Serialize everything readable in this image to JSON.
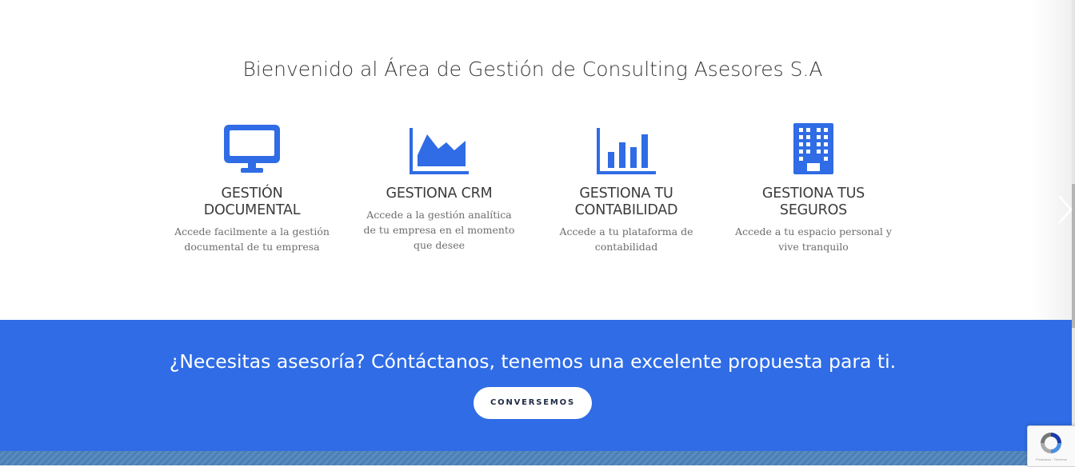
{
  "header": {
    "title": "Bienvenido al Área de Gestión de Consulting Asesores S.A"
  },
  "features": [
    {
      "icon": "monitor-icon",
      "title": "GESTIÓN DOCUMENTAL",
      "desc": "Accede facilmente a la gestión documental de tu empresa"
    },
    {
      "icon": "area-chart-icon",
      "title": "GESTIONA CRM",
      "desc": "Accede a la gestión analítica de tu empresa en el momento que desee"
    },
    {
      "icon": "bar-chart-icon",
      "title": "GESTIONA TU CONTABILIDAD",
      "desc": "Accede a tu plataforma de contabilidad"
    },
    {
      "icon": "building-icon",
      "title": "GESTIONA TUS SEGUROS",
      "desc": "Accede a tu espacio personal y vive tranquilo"
    }
  ],
  "cta_band": {
    "text": "¿Necesitas asesoría? Cóntáctanos, tenemos una excelente propuesta para ti.",
    "button_label": "CONVERSEMOS"
  },
  "recaptcha": {
    "footer": "Privacidad - Términos"
  },
  "colors": {
    "accent": "#2f6ce5",
    "heading": "#3a3a3a",
    "body_text": "#6d6d6d",
    "cta_text": "#1d2a44"
  }
}
